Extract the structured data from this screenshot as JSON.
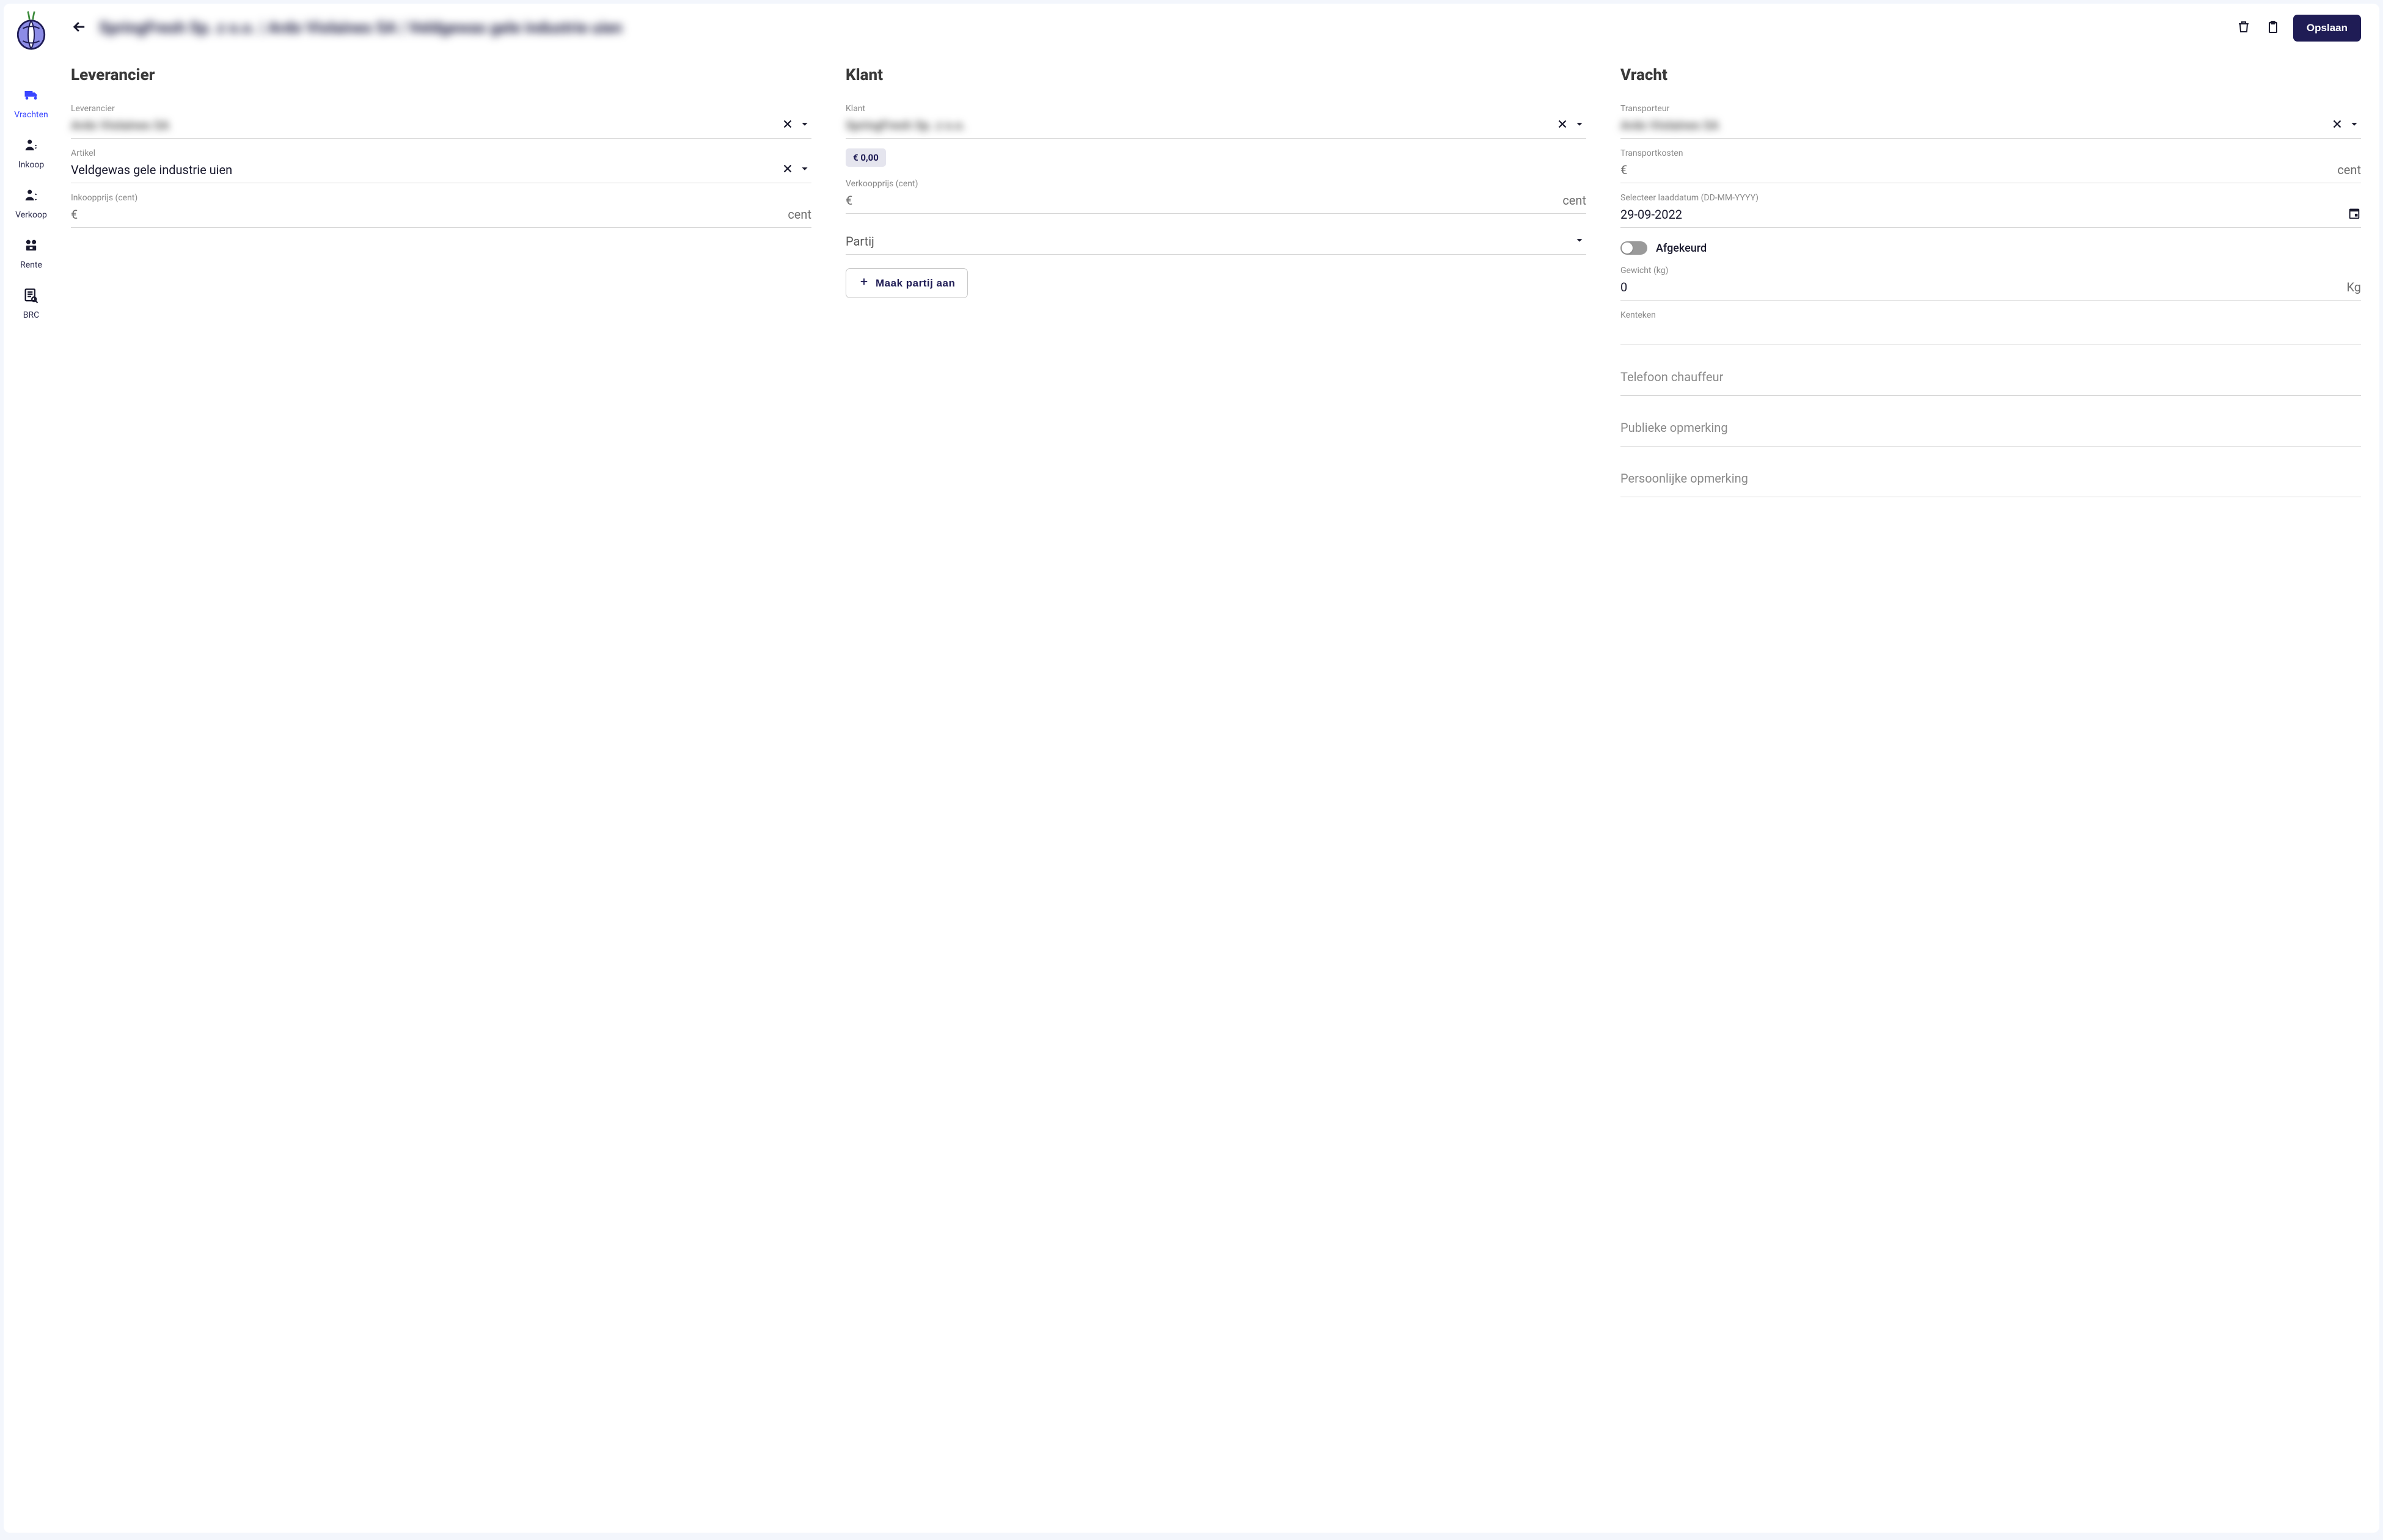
{
  "sidebar": {
    "items": [
      {
        "label": "Vrachten",
        "name": "sidebar-item-vrachten",
        "active": true
      },
      {
        "label": "Inkoop",
        "name": "sidebar-item-inkoop"
      },
      {
        "label": "Verkoop",
        "name": "sidebar-item-verkoop"
      },
      {
        "label": "Rente",
        "name": "sidebar-item-rente"
      },
      {
        "label": "BRC",
        "name": "sidebar-item-brc"
      }
    ]
  },
  "topbar": {
    "title_blurred": "SpringFresh Sp. z o.o. | Ardo Violaines SA | Veldgewas gele industrie uien",
    "save_label": "Opslaan"
  },
  "supplier": {
    "heading": "Leverancier",
    "supplier_label": "Leverancier",
    "supplier_value_blurred": "Ardo Violaines SA",
    "article_label": "Artikel",
    "article_value": "Veldgewas gele industrie uien",
    "purchase_price_label": "Inkoopprijs (cent)",
    "purchase_price_value_blurred": "  ",
    "currency_prefix": "€",
    "cent_suffix": "cent"
  },
  "customer": {
    "heading": "Klant",
    "customer_label": "Klant",
    "customer_value_blurred": "SpringFresh Sp. z o.o.",
    "chip_value": "€ 0,00",
    "sale_price_label": "Verkoopprijs (cent)",
    "sale_price_value_blurred": " ",
    "currency_prefix": "€",
    "cent_suffix": "cent",
    "batch_label": "Partij",
    "create_batch_label": "Maak partij aan"
  },
  "freight": {
    "heading": "Vracht",
    "carrier_label": "Transporteur",
    "carrier_value_blurred": "Ardo Violaines SA",
    "transport_cost_label": "Transportkosten",
    "transport_cost_value_blurred": " ",
    "currency_prefix": "€",
    "cent_suffix": "cent",
    "load_date_label": "Selecteer laaddatum (DD-MM-YYYY)",
    "load_date_value": "29-09-2022",
    "rejected_label": "Afgekeurd",
    "weight_label": "Gewicht (kg)",
    "weight_value": "0",
    "weight_suffix": "Kg",
    "license_label": "Kenteken",
    "driver_phone_placeholder": "Telefoon chauffeur",
    "public_remark_placeholder": "Publieke opmerking",
    "personal_remark_placeholder": "Persoonlijke opmerking"
  }
}
